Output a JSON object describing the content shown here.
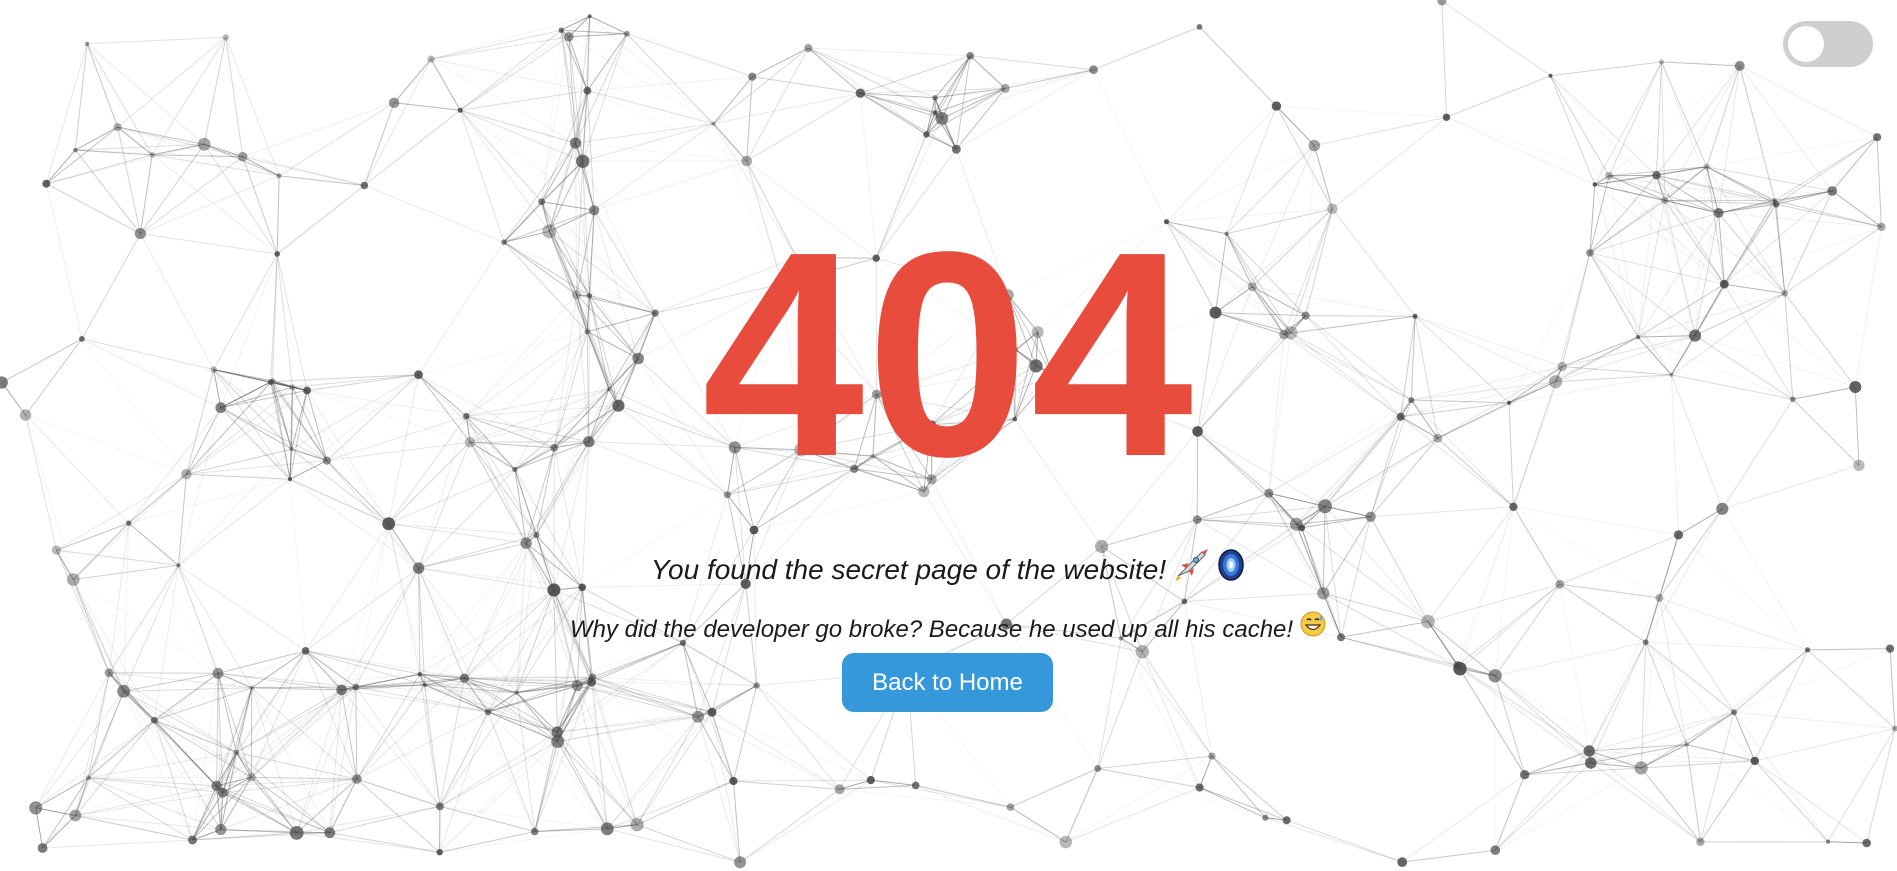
{
  "page": {
    "error_code": "404",
    "message": "You found the secret page of the website!",
    "joke": "Why did the developer go broke? Because he used up all his cache!",
    "home_button_label": "Back to Home"
  },
  "theme_toggle": {
    "state": "off"
  },
  "icons": {
    "message_icons": [
      "rocket-icon",
      "portal-icon"
    ],
    "joke_icon": "grinning-sweat-icon"
  },
  "colors": {
    "accent": "#e74c3c",
    "button": "#3498db",
    "background": "#ffffff",
    "network": "#444444",
    "toggle_track": "#cfcfcf"
  }
}
